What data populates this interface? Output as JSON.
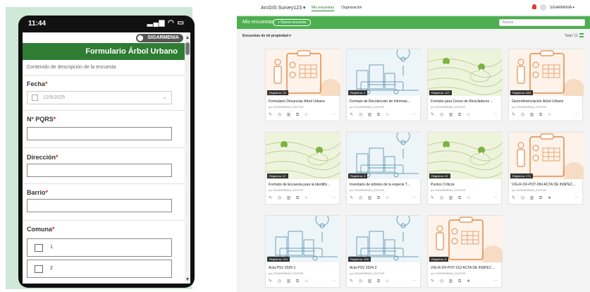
{
  "phone": {
    "status_time": "11:44",
    "status_icons": "▂▄▆ ◠ ▭",
    "user": "SIGARMENIA",
    "form_title": "Formulario Árbol Urbano",
    "description": "Contenido de descripción de la encuesta",
    "required_mark": "*",
    "fields": {
      "fecha_label": "Fecha",
      "fecha_value": "12/9/2025",
      "pqrs_label": "Nº PQRS",
      "direccion_label": "Dirección",
      "barrio_label": "Barrio",
      "comuna_label": "Comuna"
    },
    "comuna_options": [
      "1",
      "2"
    ],
    "chevron": "⌄",
    "scroll_up": "▲",
    "scroll_down": "▼"
  },
  "app": {
    "title": "ArcGIS Survey123",
    "title_caret": "▾",
    "nav_mine": "Mis encuestas",
    "nav_org": "Organización",
    "user": "SIGARMENIA",
    "section_title": "Mis encuestas",
    "new_survey": "+ Nueva encuesta",
    "search_placeholder": "Buscar",
    "filter_label": "Encuestas de mi propiedad",
    "filter_caret": "▾",
    "total": "Total: 11",
    "owner": "por SIGARMENIA_EDITOR",
    "more": "···"
  },
  "cards": [
    {
      "title": "Formulario Denuncias Árbol Urbano",
      "badge": "Registros: 76",
      "thumb": "form",
      "actions": "✎ ◷ ▥ ⧉ ☆"
    },
    {
      "title": "Formato de Recolección de Informac...",
      "badge": "Registros: 1",
      "thumb": "city",
      "actions": "✎ ◷ ▥ ⧉ ☆"
    },
    {
      "title": "Formato para Censo de Recicladores ...",
      "badge": "Registros: 127",
      "thumb": "map",
      "actions": "✎ ◷ ▥ ⧉ ☆"
    },
    {
      "title": "Georreferenciación Árbol Urbano",
      "badge": "Registros: 488",
      "thumb": "form",
      "actions": "✎ ◷ ▥ ⧉ ☆"
    },
    {
      "title": "Formato de Encuesta para la Identific...",
      "badge": "Registros: 47",
      "thumb": "map",
      "actions": "✎ ◷ ▥ ⧉ ☆"
    },
    {
      "title": "Inventario de árboles de la especie T...",
      "badge": "Registros: 0",
      "thumb": "city",
      "actions": "✎ ◷ ▥ ⧉ ☆"
    },
    {
      "title": "Puntos Críticos",
      "badge": "Registros: 92",
      "thumb": "map",
      "actions": "✎ ◷ ▥ ⧉ ☆"
    },
    {
      "title": "VIG-R-OF-POT-054 ACTA DE INSPEC...",
      "badge": "Registros: 174",
      "thumb": "form",
      "actions": "✎ ◷ ▥ ⧉ ★"
    },
    {
      "title": "Acta PSV 2025-1",
      "badge": "Registros: 194",
      "thumb": "city",
      "actions": "✎ ◷ ▥ ⧉ ☆"
    },
    {
      "title": "Acta PSV 2024-2",
      "badge": "Registros: 165",
      "thumb": "city",
      "actions": "✎ ◷ ▥ ⧉ ☆"
    },
    {
      "title": "VIG-R-OF-POT-012 ACTA DE INSPEC...",
      "badge": "Registros: 6",
      "thumb": "form",
      "actions": "✎ ◷ ▥ ⧉ ★"
    }
  ]
}
